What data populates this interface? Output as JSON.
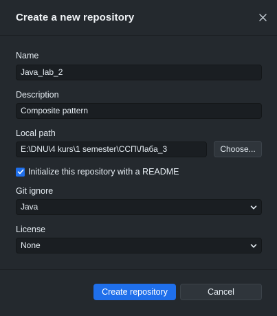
{
  "dialog": {
    "title": "Create a new repository",
    "close_icon": "close-icon"
  },
  "form": {
    "name_label": "Name",
    "name_value": "Java_lab_2",
    "description_label": "Description",
    "description_value": "Composite pattern",
    "local_path_label": "Local path",
    "local_path_value": "E:\\DNU\\4 kurs\\1 semester\\ССП\\Лаба_3",
    "choose_label": "Choose...",
    "readme_label": "Initialize this repository with a README",
    "readme_checked": true,
    "gitignore_label": "Git ignore",
    "gitignore_value": "Java",
    "license_label": "License",
    "license_value": "None"
  },
  "footer": {
    "create_label": "Create repository",
    "cancel_label": "Cancel"
  },
  "colors": {
    "background": "#24292e",
    "accent": "#1f6feb",
    "field_bg": "#1a1e22"
  }
}
